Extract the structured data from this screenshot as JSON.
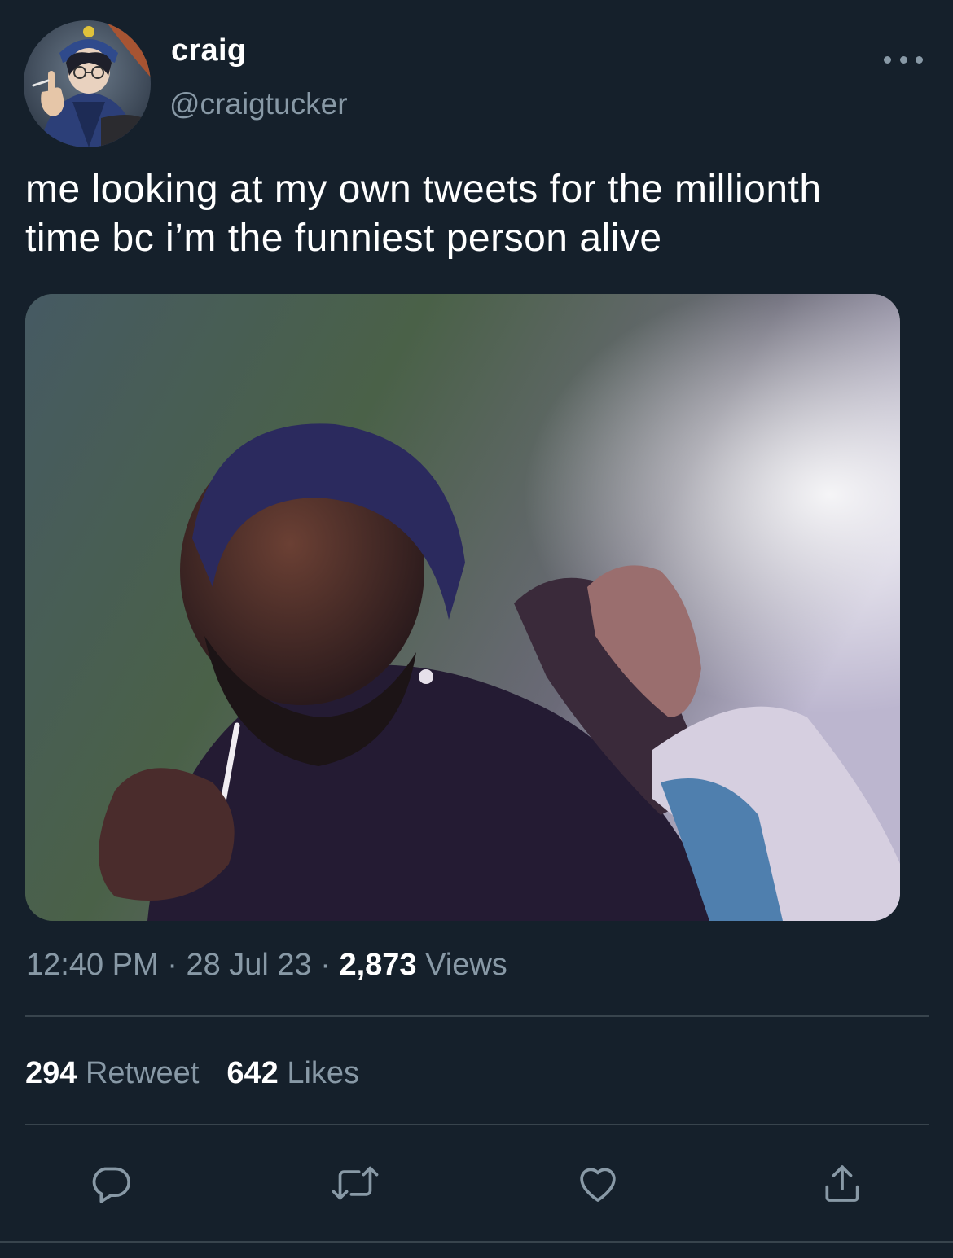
{
  "tweet": {
    "display_name": "craig",
    "handle": "@craigtucker",
    "text_line1": "me looking at my own tweets for the millionth",
    "text_line2": "time bc i’m the funniest person alive",
    "time": "12:40 PM",
    "date": "28 Jul 23",
    "separator": " · ",
    "views_count": "2,873",
    "views_label": "Views",
    "retweet_count": "294",
    "retweet_label": "Retweet",
    "likes_count": "642",
    "likes_label": "Likes"
  },
  "icons": {
    "more": "more-horizontal-icon",
    "reply": "reply-icon",
    "retweet": "retweet-icon",
    "like": "heart-icon",
    "share": "share-icon"
  },
  "colors": {
    "background": "#15202b",
    "secondary_text": "#8899a6",
    "divider": "#38444d",
    "primary_text": "#ffffff"
  }
}
